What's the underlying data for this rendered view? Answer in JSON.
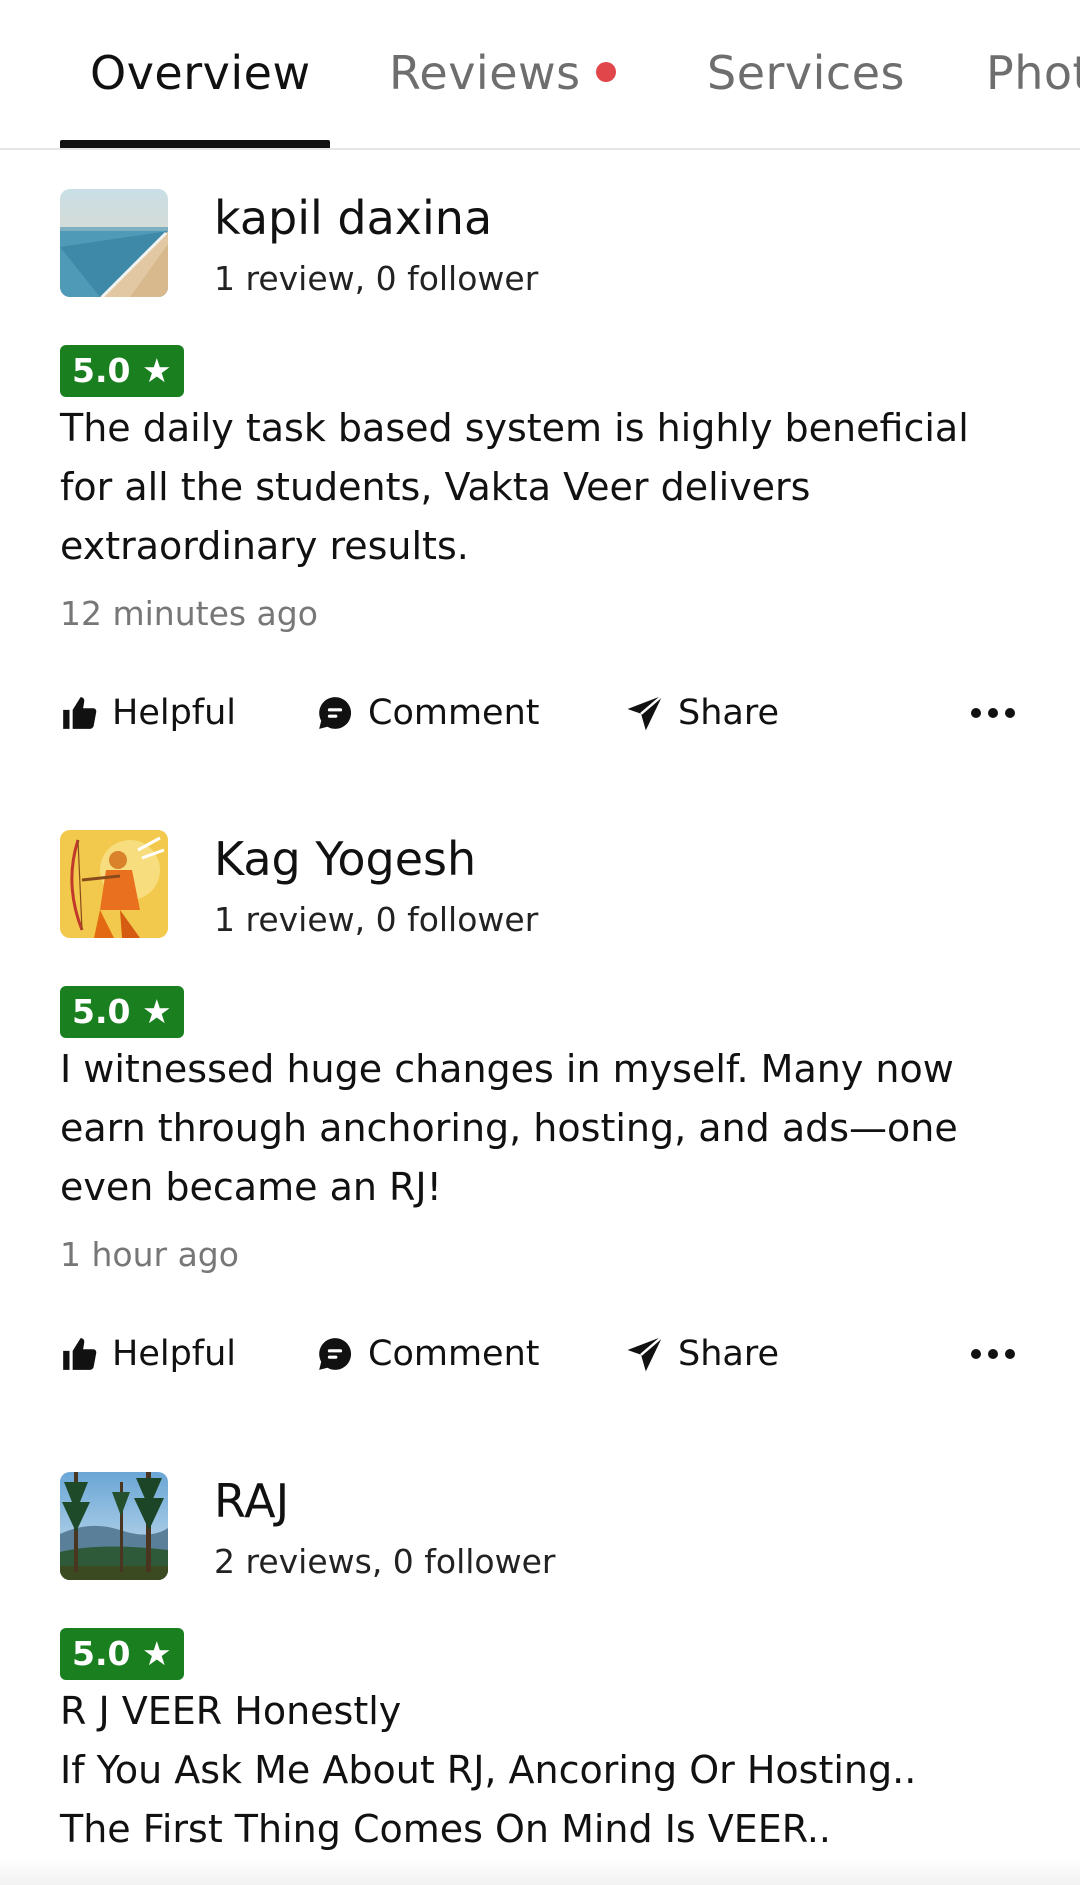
{
  "tabs": [
    {
      "label": "Overview",
      "active": true
    },
    {
      "label": "Reviews",
      "active": false,
      "has_notification_dot": true
    },
    {
      "label": "Services",
      "active": false
    },
    {
      "label": "Photos",
      "active": false
    }
  ],
  "colors": {
    "rating_badge": "#1a7f1f",
    "notification_dot": "#e0464a",
    "tab_active": "#111111",
    "tab_inactive": "#6e6e6e",
    "meta_text": "#777777"
  },
  "actions": {
    "helpful_label": "Helpful",
    "comment_label": "Comment",
    "share_label": "Share",
    "helpful_icon": "thumbs-up-icon",
    "comment_icon": "comment-icon",
    "share_icon": "send-icon",
    "more_icon": "more-horizontal-icon"
  },
  "reviews": [
    {
      "reviewer": "kapil daxina",
      "stats": "1 review, 0 follower",
      "avatar": "beach-photo",
      "rating": "5.0 ★",
      "text_lines": [
        "The daily task based system is highly beneficial",
        "for all the students, Vakta Veer delivers",
        "extraordinary results."
      ],
      "time": "12 minutes ago"
    },
    {
      "reviewer": "Kag Yogesh",
      "stats": "1 review, 0 follower",
      "avatar": "archer-illustration",
      "rating": "5.0 ★",
      "text_lines": [
        "I witnessed huge changes in myself. Many now",
        "earn through anchoring, hosting, and ads—one",
        "even became an RJ!"
      ],
      "time": "1 hour ago"
    },
    {
      "reviewer": "RAJ",
      "stats": "2 reviews, 0 follower",
      "avatar": "forest-photo",
      "rating": "5.0 ★",
      "text_lines": [
        "R J VEER Honestly",
        "If You Ask Me About RJ, Ancoring Or Hosting..",
        "The First Thing Comes On Mind Is VEER.."
      ]
    }
  ]
}
